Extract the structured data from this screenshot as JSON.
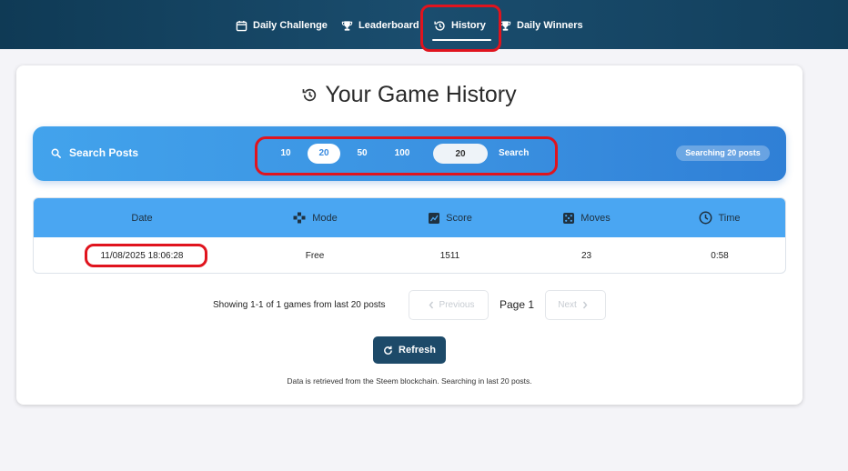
{
  "nav": {
    "items": [
      {
        "label": "Daily Challenge",
        "icon": "calendar-icon"
      },
      {
        "label": "Leaderboard",
        "icon": "trophy-icon"
      },
      {
        "label": "History",
        "icon": "history-icon",
        "active": true
      },
      {
        "label": "Daily Winners",
        "icon": "trophy-icon"
      }
    ]
  },
  "page": {
    "title": "Your Game History",
    "title_icon": "history-icon"
  },
  "search": {
    "title": "Search Posts",
    "options": [
      "10",
      "20",
      "50",
      "100"
    ],
    "selected": "20",
    "input_value": "20",
    "button_label": "Search",
    "status_badge": "Searching 20 posts"
  },
  "table": {
    "columns": [
      {
        "label": "Date",
        "icon": ""
      },
      {
        "label": "Mode",
        "icon": "gamepad-icon"
      },
      {
        "label": "Score",
        "icon": "chart-icon"
      },
      {
        "label": "Moves",
        "icon": "dice-icon"
      },
      {
        "label": "Time",
        "icon": "clock-icon"
      }
    ],
    "rows": [
      [
        "11/08/2025 18:06:28",
        "Free",
        "1511",
        "23",
        "0:58"
      ]
    ]
  },
  "pagination": {
    "summary": "Showing 1-1 of 1 games from last 20 posts",
    "previous_label": "Previous",
    "page_label": "Page 1",
    "next_label": "Next"
  },
  "refresh": {
    "label": "Refresh"
  },
  "footnote": "Data is retrieved from the Steem blockchain. Searching in last 20 posts.",
  "colors": {
    "nav_bg": "#0f3a55",
    "search_bar": "#3a90e0",
    "table_header": "#4aa6f2",
    "refresh_button": "#1d4a69",
    "annotation": "#e0141e"
  }
}
